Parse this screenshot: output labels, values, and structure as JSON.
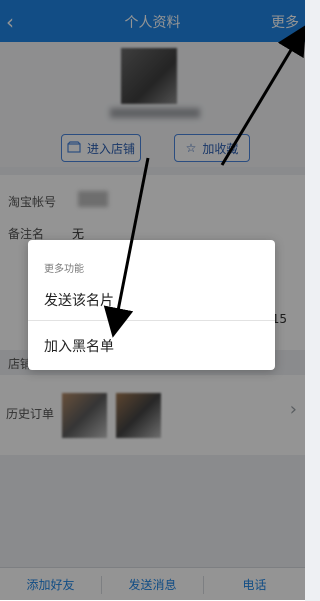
{
  "header": {
    "back_icon": "back-chevron-icon",
    "title": "个人资料",
    "more": "更多"
  },
  "profile": {
    "shop_button": "进入店铺",
    "fav_button": "加收藏",
    "shop_icon": "store-icon",
    "fav_icon": "star-icon"
  },
  "info": {
    "taobao_label": "淘宝帐号",
    "remark_label": "备注名",
    "remark_value": "无"
  },
  "mid": {
    "shop_label": "店铺",
    "right_number": "15"
  },
  "orders": {
    "label": "历史订单",
    "chevron_icon": "chevron-right-icon"
  },
  "bottom": {
    "add_friend": "添加好友",
    "send_message": "发送消息",
    "phone": "电话"
  },
  "dialog": {
    "title": "更多功能",
    "items": [
      "发送该名片",
      "加入黑名单"
    ]
  },
  "colors": {
    "header_blue": "#1f86e6",
    "accent_blue": "#2b5fb3"
  }
}
